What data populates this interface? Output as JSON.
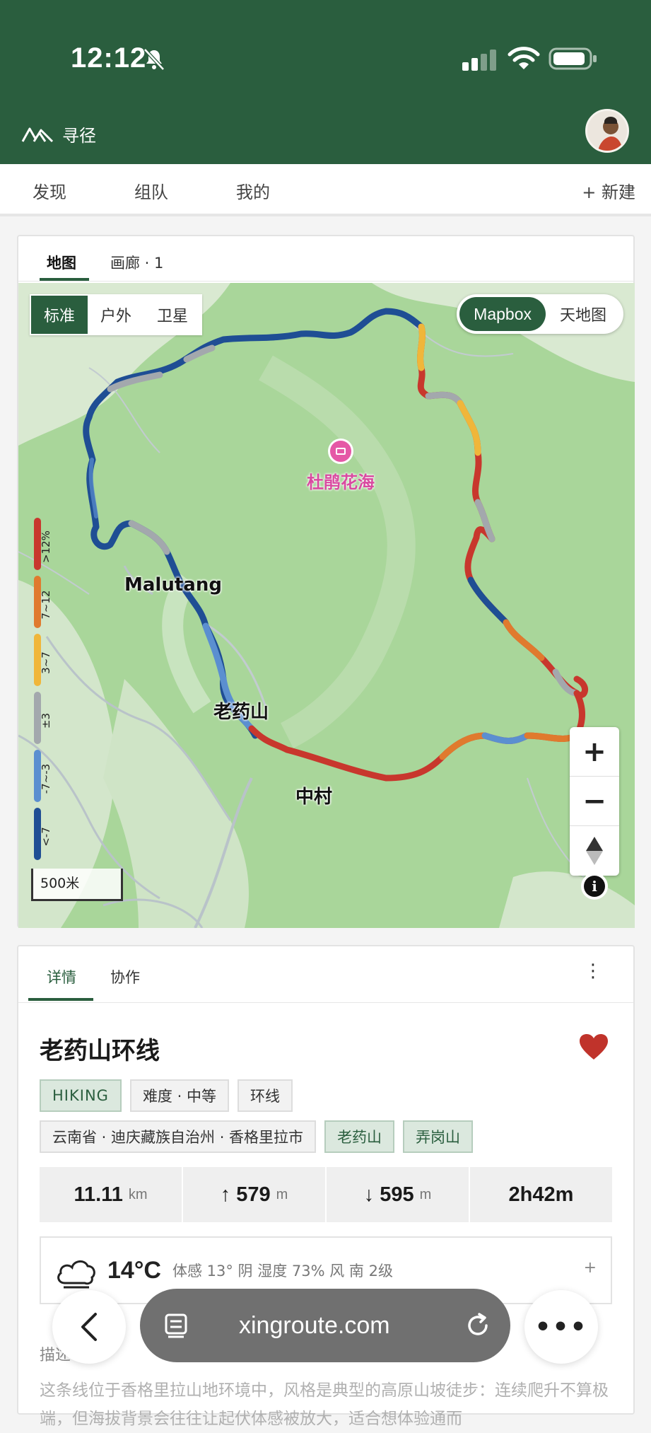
{
  "status": {
    "time": "12:12"
  },
  "header": {
    "brand": "寻径"
  },
  "nav": {
    "items": [
      "发现",
      "组队",
      "我的"
    ],
    "new_label": "+ 新建"
  },
  "map_card": {
    "tabs": [
      "地图",
      "画廊 · 1"
    ],
    "styles": [
      "标准",
      "户外",
      "卫星"
    ],
    "providers": [
      "Mapbox",
      "天地图"
    ],
    "legend": [
      {
        "label": ">12%",
        "color": "#c8372d"
      },
      {
        "label": "7~12",
        "color": "#e07a2e"
      },
      {
        "label": "3~7",
        "color": "#f0b63a"
      },
      {
        "label": "±3",
        "color": "#a3a8ad"
      },
      {
        "label": "-7~-3",
        "color": "#5b8fd0"
      },
      {
        "label": "<-7",
        "color": "#1f4e94"
      }
    ],
    "scale": "500米",
    "labels": {
      "malutang": "Malutang",
      "laoyaoshan": "老药山",
      "zhongcun": "中村",
      "poi": "杜鹃花海"
    },
    "zoom_in": "+",
    "zoom_out": "−"
  },
  "detail_card": {
    "tabs": [
      "详情",
      "协作"
    ],
    "more": "⋮",
    "title": "老药山环线",
    "tags_row1": [
      "HIKING",
      "难度 · 中等",
      "环线"
    ],
    "tags_row2": [
      "云南省 · 迪庆藏族自治州 · 香格里拉市",
      "老药山",
      "弄岗山"
    ],
    "stats": {
      "distance": "11.11",
      "distance_unit": "km",
      "ascent": "↑ 579",
      "ascent_unit": "m",
      "descent": "↓ 595",
      "descent_unit": "m",
      "duration": "2h42m"
    },
    "weather": {
      "temp": "14°C",
      "detail": "体感 13°  阴  湿度 73%  风 南 2级",
      "plus": "+"
    },
    "desc_head": "描述",
    "desc": "这条线位于香格里拉山地环境中，风格是典型的高原山坡徒步：连续爬升不算极端，但海拔背景会往往让起伏体感被放大，适合想体验通而"
  },
  "browser": {
    "url": "xingroute.com"
  }
}
